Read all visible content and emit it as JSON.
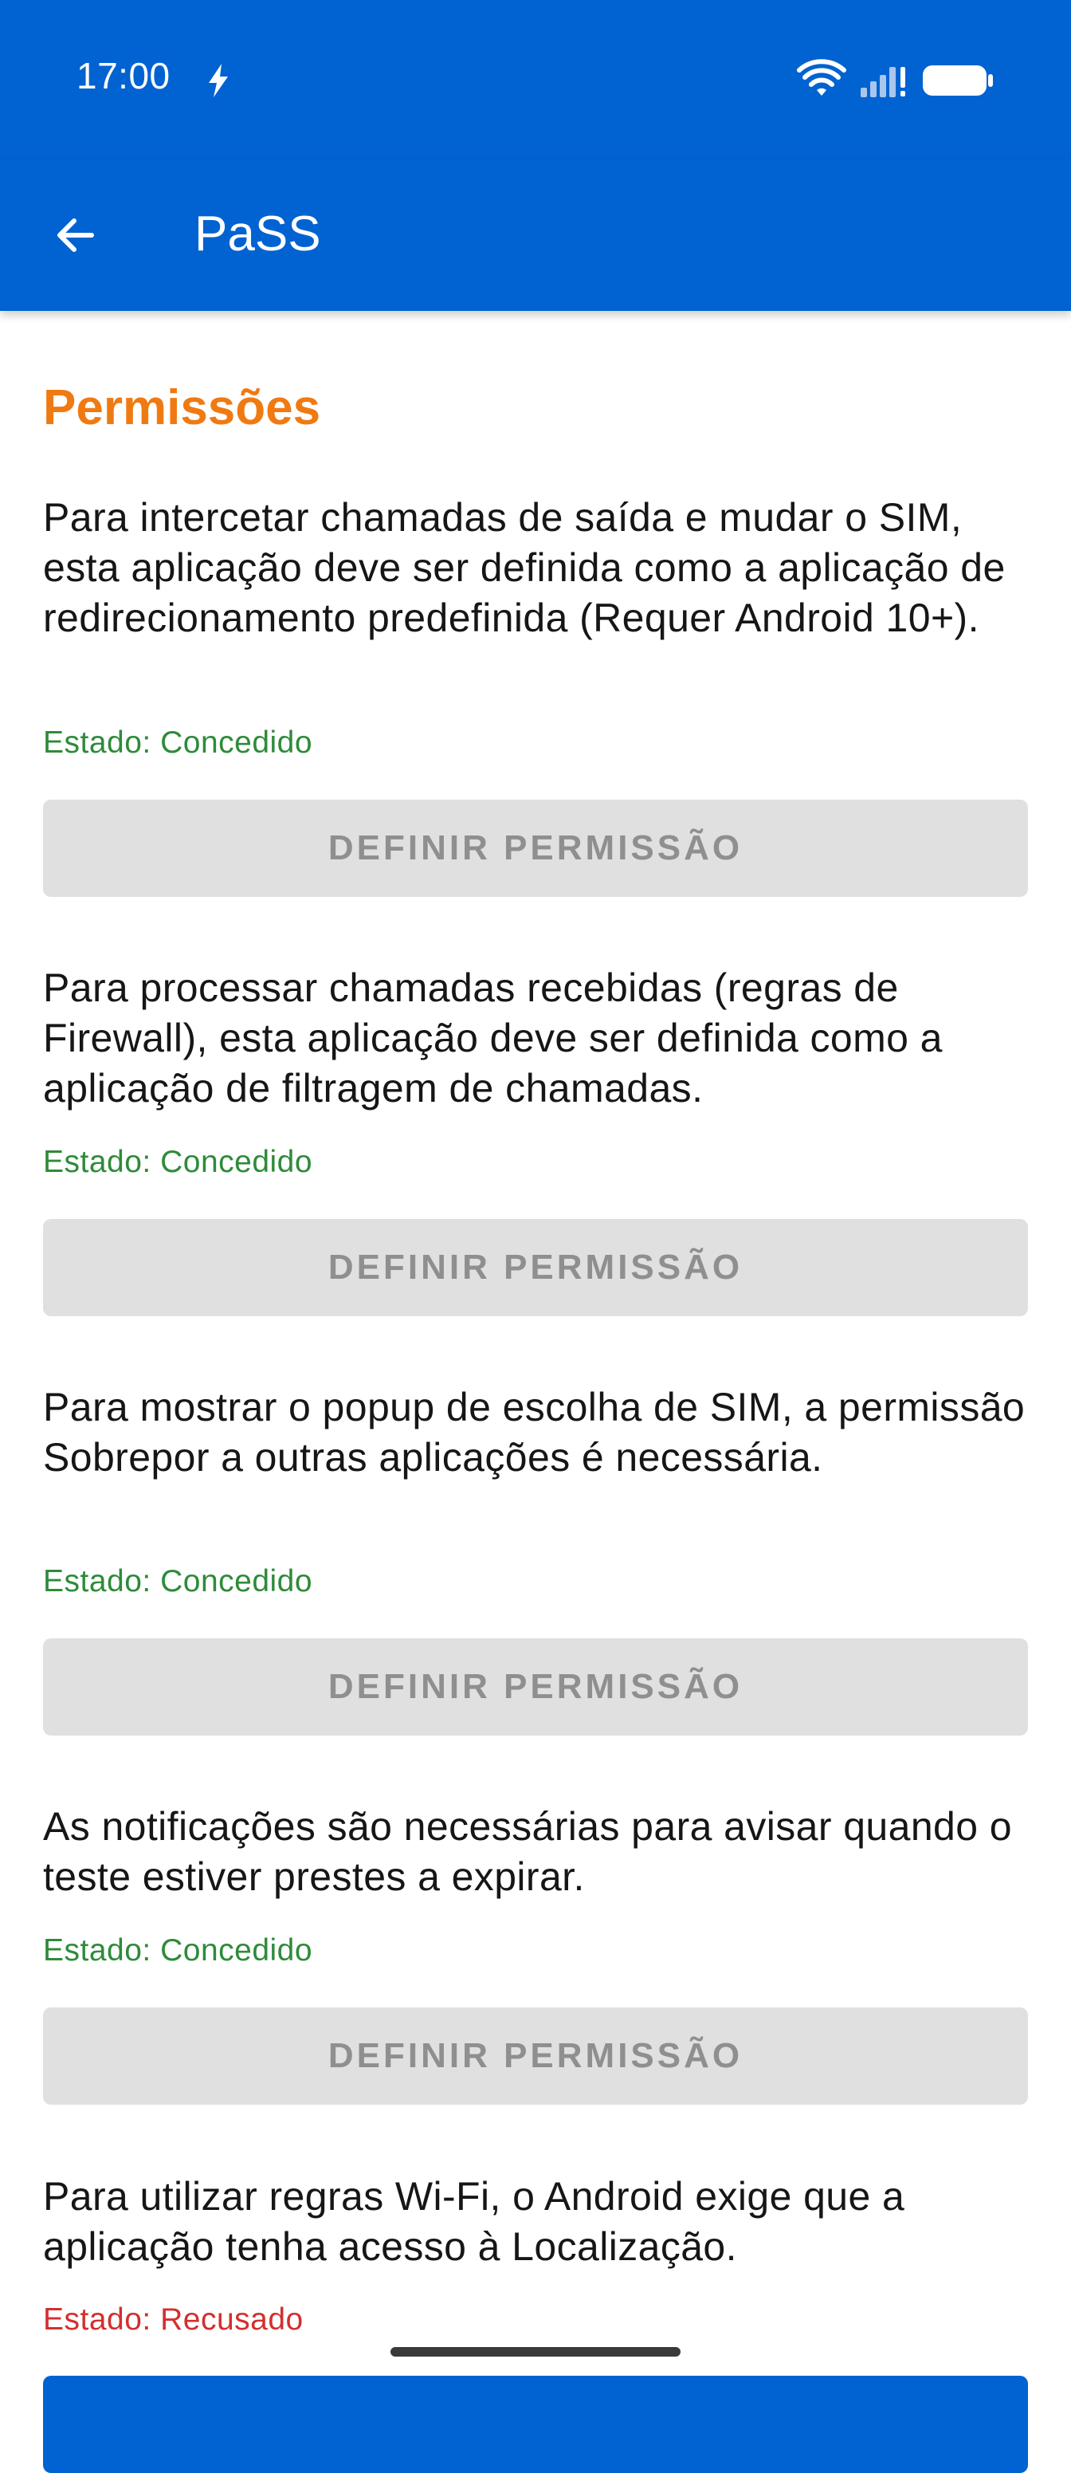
{
  "status_bar": {
    "time": "17:00",
    "icons": [
      "flash-icon",
      "wifi-icon",
      "signal-icon",
      "battery-icon"
    ]
  },
  "app_bar": {
    "title": "PaSS",
    "back_icon": "arrow-left-icon"
  },
  "section": {
    "title": "Permissões"
  },
  "permissions": [
    {
      "text": "Para intercetar chamadas de saída e mudar o SIM, esta aplicação deve ser definida como a aplicação de redirecionamento predefinida (Requer Android 10+).",
      "status": "Estado: Concedido",
      "button": "DEFINIR PERMISSÃO"
    },
    {
      "text": "Para processar chamadas recebidas (regras de Firewall), esta aplicação deve ser definida como a aplicação de filtragem de chamadas.",
      "status": "Estado: Concedido",
      "button": "DEFINIR PERMISSÃO"
    },
    {
      "text": "Para mostrar o popup de escolha de SIM, a permissão Sobrepor a outras aplicações é necessária.",
      "status": "Estado: Concedido",
      "button": "DEFINIR PERMISSÃO"
    },
    {
      "text": "As notificações são necessárias para avisar quando o teste estiver prestes a expirar.",
      "status": "Estado: Concedido",
      "button": "DEFINIR PERMISSÃO"
    },
    {
      "text": "Para utilizar regras Wi-Fi, o Android exige que a aplicação tenha acesso à Localização.",
      "status": "Estado: Recusado"
    }
  ],
  "colors": {
    "primary": "#0063d1",
    "accent": "#f07a12",
    "granted": "#2e8b3a",
    "denied": "#d32f2f",
    "disabled_button": "#e0e0e0"
  }
}
